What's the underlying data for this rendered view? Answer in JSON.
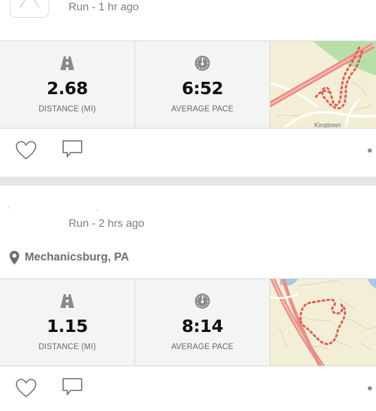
{
  "activities": [
    {
      "meta": "Run - 1 hr ago",
      "location": "",
      "stats": [
        {
          "icon": "road-icon",
          "value": "2.68",
          "label": "DISTANCE (MI)"
        },
        {
          "icon": "speedometer-icon",
          "value": "6:52",
          "label": "AVERAGE PACE"
        }
      ],
      "map_label": "Kingtown"
    },
    {
      "meta": "Run - 2 hrs ago",
      "location": "Mechanicsburg, PA",
      "stats": [
        {
          "icon": "road-icon",
          "value": "1.15",
          "label": "DISTANCE (MI)"
        },
        {
          "icon": "speedometer-icon",
          "value": "8:14",
          "label": "AVERAGE PACE"
        }
      ]
    }
  ],
  "colors": {
    "route": "#e8554e",
    "map_bg": "#f3efd6",
    "park": "#b9dfa8",
    "water": "#a8c8e8",
    "icon_gray": "#8a8a8a"
  }
}
